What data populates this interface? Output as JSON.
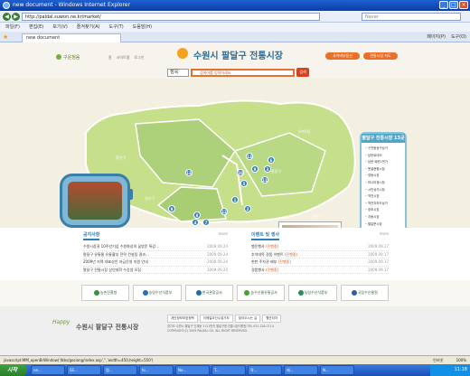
{
  "window": {
    "title": "new document - Windows Internet Explorer",
    "url": "http://paldal.suwon.ne.kr/market/",
    "web_search_placeholder": "Naver"
  },
  "menu": [
    "파일(F)",
    "편집(E)",
    "보기(V)",
    "즐겨찾기(A)",
    "도구(T)",
    "도움말(H)"
  ],
  "tab": {
    "label": "new document"
  },
  "toolbar": {
    "page": "페이지(P)",
    "tools": "도구(O)"
  },
  "header": {
    "site_title": "수원시 팔달구 전통시장",
    "logo_text": "Happy",
    "home_link": "구운청음",
    "small_links": [
      "홈",
      "사이트맵",
      "로그인"
    ],
    "btn_left": "사이버부동산",
    "btn_right": "전통시장 지도",
    "search_select": "점목",
    "search_placeholder": "검색어를 입력하세요",
    "search_button": "검색"
  },
  "map": {
    "labels": [
      "장안구",
      "권선구",
      "우만1동",
      "팔달구",
      "영통구"
    ],
    "pins": [
      "13",
      "6",
      "10",
      "9",
      "13",
      "1",
      "5",
      "2",
      "11",
      "3",
      "4",
      "8",
      "7",
      "9",
      "12"
    ],
    "photo_caption": "아래 사진을 클릭하세요"
  },
  "panel": {
    "title": "팔달구 전통시장 13곳",
    "items": [
      "구천동공구상가",
      "남문로데오",
      "남문 패션1번가",
      "못골종합시장",
      "영동시장",
      "미나리광시장",
      "시민상가시장",
      "역전시장",
      "역전지하도상가",
      "정조시장",
      "지동시장",
      "팔달문시장",
      "매산시장"
    ]
  },
  "boards": {
    "left": {
      "title": "공지사항",
      "more": "more",
      "rows": [
        {
          "text": "수원시장권 10주년기념 수원화성의 꿈방문 특강...",
          "date": "2009.09.24"
        },
        {
          "text": "팔달구 유통물 유통활성 전략 컨설팅 결과...",
          "date": "2009.09.24"
        },
        {
          "text": "2009년 지역 대표상인 자금운영 지원 안내",
          "date": "2009.09.24"
        },
        {
          "text": "팔달구 전통시장 상인대학 수강생 모집",
          "date": "2009.09.24"
        }
      ]
    },
    "right": {
      "title": "이벤트 및 행사",
      "more": "more",
      "rows": [
        {
          "text": "행운행사",
          "tag": "(진행중)",
          "date": "2009.09.17"
        },
        {
          "text": "추석대목 경품 이벤트",
          "tag": "(진행중)",
          "date": "2009.09.17"
        },
        {
          "text": "현판 주차권 배부",
          "tag": "(진행중)",
          "date": "2009.09.17"
        },
        {
          "text": "경품행사",
          "tag": "(진행중)",
          "date": "2009.09.17"
        }
      ]
    }
  },
  "partners": [
    {
      "name": "농촌진흥청",
      "color": "#3a8f3a"
    },
    {
      "name": "농림수산식품부",
      "color": "#2a6cb8"
    },
    {
      "name": "한국관광공사",
      "color": "#1c6ab8"
    },
    {
      "name": "농수산물유통공사",
      "color": "#4aa030"
    },
    {
      "name": "농림수산식품부",
      "color": "#2f8a5a"
    },
    {
      "name": "국립수산물원",
      "color": "#2a5fa8"
    }
  ],
  "footer": {
    "logo": "Happy",
    "title": "수원시 팔달구 전통시장",
    "links": [
      "개인정보보호정책",
      "이메일무단수집거부",
      "찾아오시는 길",
      "웹관리자"
    ],
    "lines": [
      "경기도 수원시 팔달구 인계동 1111번지 팔달구청 전통시장지원팀 TEL 031-228-7114",
      "COPYRIGHT(C) 2009 PALDAL GU. ALL RIGHT RESERVED."
    ]
  },
  "status": {
    "text": "javascript:MM_openBrWindow('/bbs/gosiang/index.asp','','width=450,height=550')",
    "zone": "인터넷",
    "zoom": "100%"
  },
  "taskbar": {
    "start": "시작",
    "items": [
      "ne...",
      "SS...",
      "맵...",
      "hi...",
      "No...",
      "T...",
      "작...",
      "제...",
      "N..."
    ],
    "clock": "11:18"
  }
}
